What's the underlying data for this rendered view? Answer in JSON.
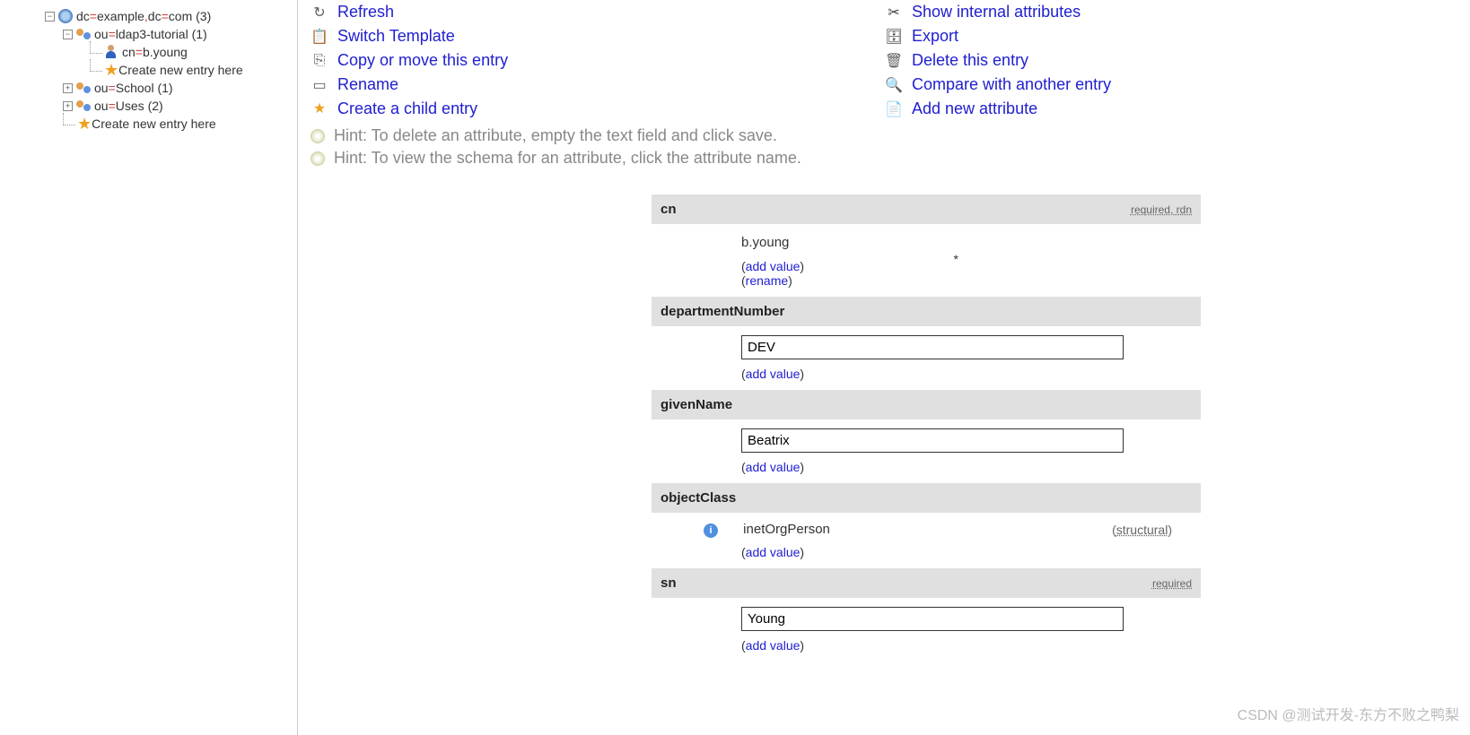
{
  "tree": {
    "root": {
      "prefix_dc1": "dc",
      "val1": "example",
      "prefix_dc2": "dc",
      "val2": "com",
      "count": "(3)"
    },
    "ou1": {
      "prefix": "ou",
      "val": "ldap3-tutorial",
      "count": "(1)"
    },
    "cn": {
      "prefix": "cn",
      "val": "b.young"
    },
    "create1": "Create new entry here",
    "ou2": {
      "prefix": "ou",
      "val": "School",
      "count": "(1)"
    },
    "ou3": {
      "prefix": "ou",
      "val": "Uses",
      "count": "(2)"
    },
    "create2": "Create new entry here"
  },
  "actions": {
    "left": {
      "refresh": "Refresh",
      "switch": "Switch Template",
      "copy": "Copy or move this entry",
      "rename": "Rename",
      "child": "Create a child entry"
    },
    "right": {
      "internal": "Show internal attributes",
      "export": "Export",
      "delete": "Delete this entry",
      "compare": "Compare with another entry",
      "addattr": "Add new attribute"
    }
  },
  "hints": {
    "h1": "Hint: To delete an attribute, empty the text field and click save.",
    "h2": "Hint: To view the schema for an attribute, click the attribute name."
  },
  "attrs": {
    "cn": {
      "name": "cn",
      "meta": "required, rdn",
      "value": "b.young",
      "addvalue": "add value",
      "rename": "rename"
    },
    "dept": {
      "name": "departmentNumber",
      "value": "DEV",
      "addvalue": "add value"
    },
    "given": {
      "name": "givenName",
      "value": "Beatrix",
      "addvalue": "add value"
    },
    "oc": {
      "name": "objectClass",
      "value": "inetOrgPerson",
      "meta": "structural",
      "addvalue": "add value"
    },
    "sn": {
      "name": "sn",
      "meta": "required",
      "value": "Young",
      "addvalue": "add value"
    }
  },
  "watermark": "CSDN @测试开发-东方不败之鸭梨"
}
